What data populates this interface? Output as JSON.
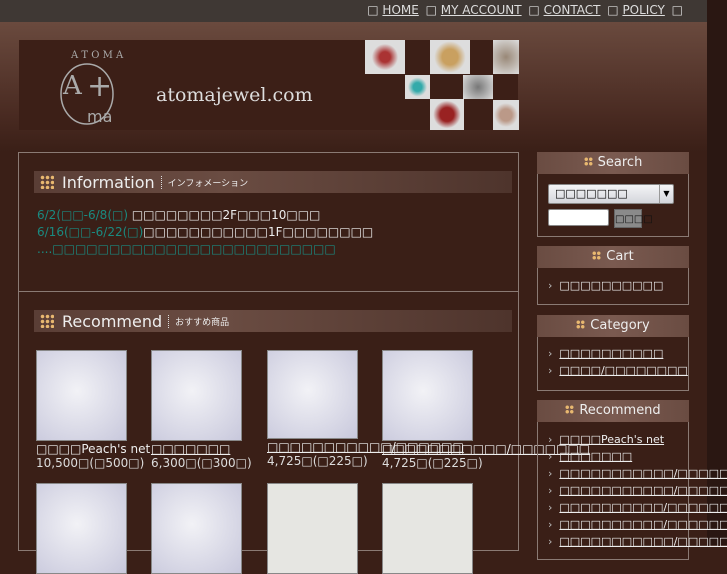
{
  "topnav": {
    "items": [
      "HOME",
      "MY ACCOUNT",
      "CONTACT",
      "POLICY"
    ]
  },
  "header": {
    "site_name": "atomajewel.com",
    "logo_text": "ATOMA A+ ma"
  },
  "information": {
    "title": "Information",
    "subtitle": "インフォメーション",
    "lines": [
      {
        "date": "6/2(□□-6/8(□)",
        "text": " □□□□□□□□2F□□□10□□□"
      },
      {
        "date": "6/16(□□-6/22(□)",
        "text": "□□□□□□□□□□□1F□□□□□□□□"
      },
      {
        "date": "....",
        "text": "□□□□□□□□□□□□□□□□□□□□□□□□□"
      }
    ]
  },
  "recommend": {
    "title": "Recommend",
    "subtitle": "おすすめ商品",
    "products": [
      {
        "name": "□□□□Peach's net",
        "price": "10,500□(□500□)"
      },
      {
        "name": "□□□□□□□",
        "price": "6,300□(□300□)"
      },
      {
        "name": "□□□□□□□□□□□/□□□□□□",
        "price": "4,725□(□225□)"
      },
      {
        "name": "□□□□□□□□□□□/□□□□□□□",
        "price": "4,725□(□225□)"
      },
      {
        "name": "",
        "price": ""
      },
      {
        "name": "",
        "price": ""
      },
      {
        "name": "",
        "price": ""
      },
      {
        "name": "",
        "price": ""
      }
    ]
  },
  "sidebar": {
    "search": {
      "title": "Search",
      "select_value": "□□□□□□□",
      "input_value": "",
      "button": "□□□□"
    },
    "cart": {
      "title": "Cart",
      "items": [
        "□□□□□□□□□□"
      ]
    },
    "category": {
      "title": "Category",
      "items": [
        "□□□□□□□□□□",
        "□□□□/□□□□□□□□"
      ]
    },
    "recommend": {
      "title": "Recommend",
      "items": [
        "□□□□Peach's net",
        "□□□□□□□",
        "□□□□□□□□□□□/□□□□□□",
        "□□□□□□□□□□□/□□□□□□□",
        "□□□□□□□□□□/□□□□□□",
        "□□□□□□□□□□/□□□□□□□",
        "□□□□□□□□□□□/□□□□□□"
      ]
    }
  }
}
